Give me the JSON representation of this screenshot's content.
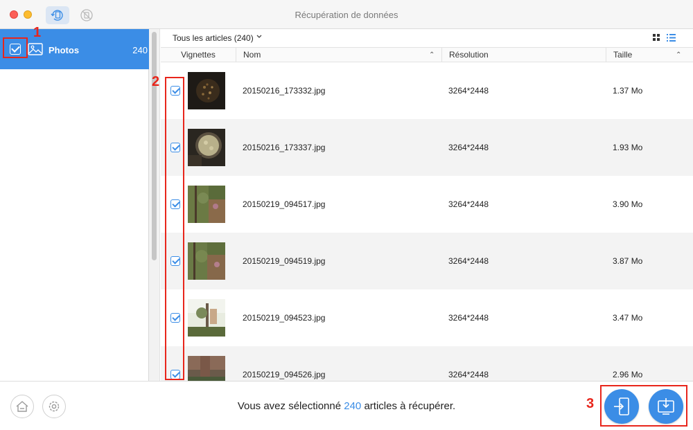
{
  "window": {
    "title": "Récupération de données",
    "toolbar_icons": [
      "device-restore-icon",
      "backup-icon"
    ]
  },
  "sidebar": {
    "items": [
      {
        "label": "Photos",
        "count": "240",
        "checked": true,
        "icon": "photos-icon"
      }
    ]
  },
  "content": {
    "filter_label": "Tous les articles (240)",
    "view_modes": [
      "grid-view-icon",
      "list-view-icon"
    ],
    "columns": {
      "thumbnail": "Vignettes",
      "name": "Nom",
      "resolution": "Résolution",
      "size": "Taille"
    },
    "rows": [
      {
        "name": "20150216_173332.jpg",
        "resolution": "3264*2448",
        "size": "1.37 Mo",
        "checked": true
      },
      {
        "name": "20150216_173337.jpg",
        "resolution": "3264*2448",
        "size": "1.93 Mo",
        "checked": true
      },
      {
        "name": "20150219_094517.jpg",
        "resolution": "3264*2448",
        "size": "3.90 Mo",
        "checked": true
      },
      {
        "name": "20150219_094519.jpg",
        "resolution": "3264*2448",
        "size": "3.87 Mo",
        "checked": true
      },
      {
        "name": "20150219_094523.jpg",
        "resolution": "3264*2448",
        "size": "3.47 Mo",
        "checked": true
      },
      {
        "name": "20150219_094526.jpg",
        "resolution": "3264*2448",
        "size": "2.96 Mo",
        "checked": true
      }
    ]
  },
  "footer": {
    "status_before": "Vous avez sélectionné ",
    "status_count": "240",
    "status_after": " articles à récupérer.",
    "left_buttons": [
      "home-icon",
      "settings-icon"
    ],
    "action_buttons": [
      "to-device-icon",
      "to-computer-icon"
    ]
  },
  "annotations": [
    "1",
    "2",
    "3"
  ],
  "colors": {
    "accent": "#3b8de6",
    "annotation": "#e8251b"
  }
}
